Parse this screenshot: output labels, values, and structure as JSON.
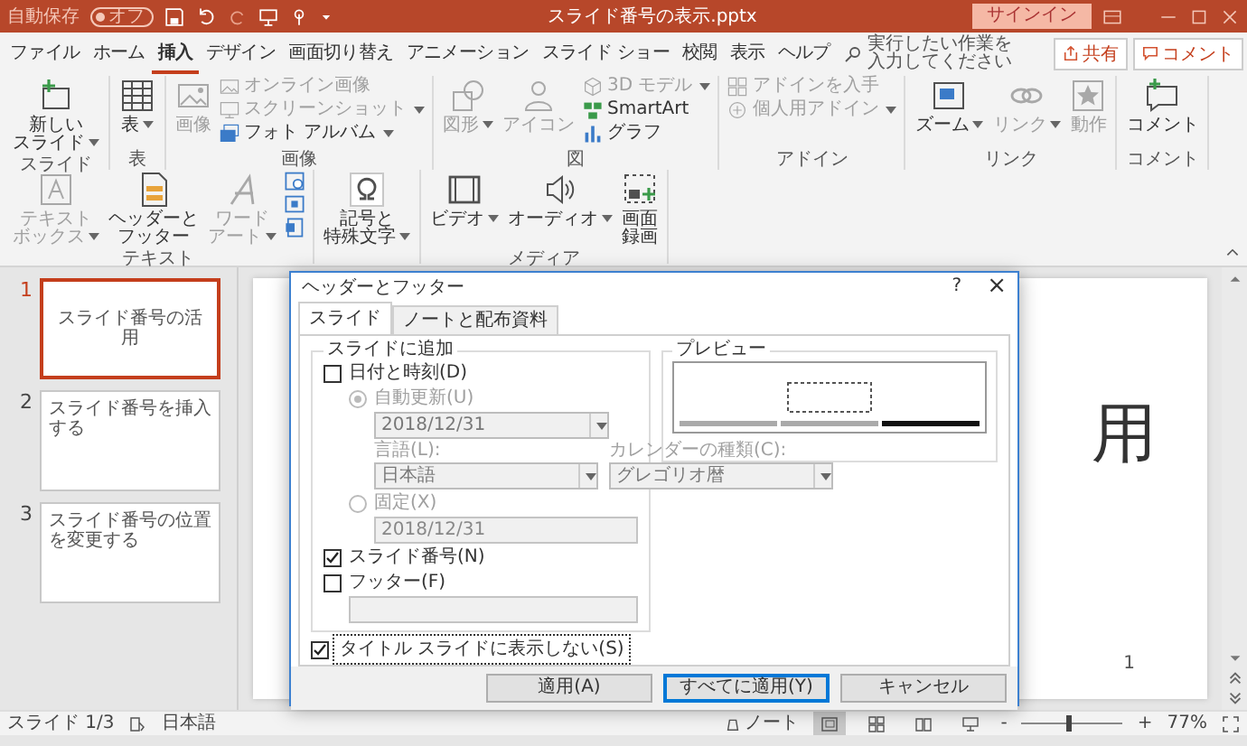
{
  "title_bar": {
    "autosave": {
      "label": "自動保存",
      "toggle": "オフ",
      "on": false
    },
    "title": "スライド番号の表示.pptx",
    "sign_in": "サインイン"
  },
  "menu_tabs": [
    {
      "label": "ファイル",
      "selected": false
    },
    {
      "label": "ホーム",
      "selected": false
    },
    {
      "label": "挿入",
      "selected": true
    },
    {
      "label": "デザイン",
      "selected": false
    },
    {
      "label": "画面切り替え",
      "selected": false
    },
    {
      "label": "アニメーション",
      "selected": false
    },
    {
      "label": "スライド ショー",
      "selected": false
    },
    {
      "label": "校閲",
      "selected": false
    },
    {
      "label": "表示",
      "selected": false
    },
    {
      "label": "ヘルプ",
      "selected": false
    }
  ],
  "tell_me": {
    "placeholder": "実行したい作業を入力してください"
  },
  "share_button": "共有",
  "comments_button": "コメント",
  "ribbon": {
    "groups": [
      {
        "label": "スライド",
        "items": [
          {
            "kind": "large",
            "lines": [
              "新しい",
              "スライド"
            ],
            "dropdown": true,
            "disabled": false
          }
        ]
      },
      {
        "label": "表",
        "items": [
          {
            "kind": "large",
            "label": "表",
            "dropdown": true,
            "disabled": false
          }
        ]
      },
      {
        "label": "画像",
        "items": [
          {
            "kind": "large",
            "label": "画像",
            "dropdown": false,
            "disabled": true
          },
          {
            "kind": "small",
            "label": "オンライン画像",
            "dropdown": false,
            "disabled": true
          },
          {
            "kind": "small",
            "label": "スクリーンショット",
            "dropdown": true,
            "disabled": true
          },
          {
            "kind": "small",
            "label": "フォト アルバム",
            "dropdown": true,
            "disabled": false
          }
        ]
      },
      {
        "label": "図",
        "items": [
          {
            "kind": "large",
            "label": "図形",
            "dropdown": true,
            "disabled": true
          },
          {
            "kind": "large",
            "label": "アイコン",
            "dropdown": false,
            "disabled": true
          },
          {
            "kind": "small",
            "label": "3D モデル",
            "dropdown": true,
            "disabled": true
          },
          {
            "kind": "small",
            "label": "SmartArt",
            "dropdown": false,
            "disabled": false
          },
          {
            "kind": "small",
            "label": "グラフ",
            "dropdown": false,
            "disabled": false
          }
        ]
      },
      {
        "label": "アドイン",
        "items": [
          {
            "kind": "small",
            "label": "アドインを入手",
            "dropdown": false,
            "disabled": true
          },
          {
            "kind": "small",
            "label": "個人用アドイン",
            "dropdown": true,
            "disabled": true
          }
        ]
      },
      {
        "label": "リンク",
        "items": [
          {
            "kind": "large",
            "label": "ズーム",
            "dropdown": true,
            "disabled": false
          },
          {
            "kind": "large",
            "label": "リンク",
            "dropdown": true,
            "disabled": true
          },
          {
            "kind": "large",
            "label": "動作",
            "dropdown": false,
            "disabled": true
          }
        ]
      },
      {
        "label": "コメント",
        "items": [
          {
            "kind": "large",
            "label": "コメント",
            "dropdown": false,
            "disabled": false
          }
        ]
      },
      {
        "label": "テキスト",
        "items": [
          {
            "kind": "large",
            "lines": [
              "テキスト",
              "ボックス"
            ],
            "dropdown": true,
            "disabled": true
          },
          {
            "kind": "large",
            "lines": [
              "ヘッダーと",
              "フッター"
            ],
            "dropdown": false,
            "disabled": false
          },
          {
            "kind": "large",
            "lines": [
              "ワード",
              "アート"
            ],
            "dropdown": true,
            "disabled": true
          },
          {
            "kind": "icon",
            "disabled": false
          },
          {
            "kind": "icon",
            "disabled": false
          },
          {
            "kind": "icon",
            "disabled": false
          }
        ]
      },
      {
        "items": [
          {
            "kind": "large",
            "lines": [
              "記号と",
              "特殊文字"
            ],
            "dropdown": true,
            "disabled": false
          }
        ]
      },
      {
        "label": "メディア",
        "items": [
          {
            "kind": "large",
            "label": "ビデオ",
            "dropdown": true,
            "disabled": false
          },
          {
            "kind": "large",
            "label": "オーディオ",
            "dropdown": true,
            "disabled": false
          },
          {
            "kind": "large",
            "lines": [
              "画面",
              "録画"
            ],
            "dropdown": false,
            "disabled": false
          }
        ]
      }
    ]
  },
  "slides": [
    {
      "number": "1",
      "kind": "title",
      "title": "スライド番号の活用",
      "selected": true
    },
    {
      "number": "2",
      "kind": "content",
      "title": "スライド番号を挿入する",
      "selected": false
    },
    {
      "number": "3",
      "kind": "content",
      "title": "スライド番号の位置を変更する",
      "selected": false
    }
  ],
  "editor": {
    "visible_title": "用",
    "page_number": "1"
  },
  "dialog": {
    "title": "ヘッダーとフッター",
    "help": "?",
    "close": "×",
    "tabs": [
      {
        "label": "スライド",
        "selected": true
      },
      {
        "label": "ノートと配布資料",
        "selected": false
      }
    ],
    "group_label": "スライドに追加",
    "date_time": {
      "label": "日付と時刻(D)",
      "checked": false
    },
    "auto_update": {
      "label": "自動更新(U)",
      "selected": true,
      "disabled": true,
      "value": "2018/12/31"
    },
    "language": {
      "label": "言語(L):",
      "value": "日本語",
      "disabled": true
    },
    "calendar": {
      "label": "カレンダーの種類(C):",
      "value": "グレゴリオ暦",
      "disabled": true
    },
    "fixed": {
      "label": "固定(X)",
      "selected": false,
      "disabled": true,
      "value": "2018/12/31"
    },
    "slide_number": {
      "label": "スライド番号(N)",
      "checked": true
    },
    "footer": {
      "label": "フッター(F)",
      "checked": false
    },
    "preview_label": "プレビュー",
    "dont_show_on_title": {
      "label": "タイトル スライドに表示しない(S)",
      "checked": true
    },
    "buttons": [
      {
        "label": "適用(A)",
        "default": false
      },
      {
        "label": "すべてに適用(Y)",
        "default": true
      },
      {
        "label": "キャンセル",
        "default": false
      }
    ]
  },
  "status_bar": {
    "slide_indicator": "スライド 1/3",
    "language": "日本語",
    "notes": "ノート",
    "views": [
      {
        "selected": true
      },
      {
        "selected": false
      },
      {
        "selected": false
      },
      {
        "selected": false
      }
    ],
    "zoom_out": "-",
    "zoom": {
      "level": 0.45
    },
    "zoom_in": "+",
    "zoom_percent": "77%"
  }
}
